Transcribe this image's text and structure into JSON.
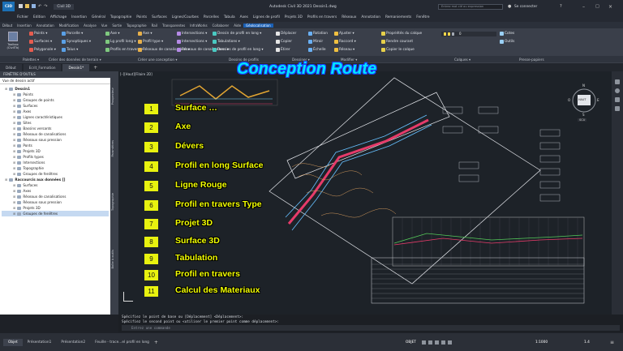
{
  "app": {
    "title": "Autodesk Civil 3D 2021   Dessin1.dwg",
    "search_placeholder": "Entrez mot clé ou expression",
    "signin": "Se connecter",
    "workspace": "Civil 3D",
    "logo": "C3D"
  },
  "menubar": [
    "Fichier",
    "Edition",
    "Affichage",
    "Insertion",
    "Général",
    "Topographie",
    "Points",
    "Surfaces",
    "Lignes/Courbes",
    "Parcelles",
    "Tabula",
    "Axes",
    "Lignes de profil",
    "Projets 3D",
    "Profils en travers",
    "Réseaux",
    "Annotation",
    "Remaniements",
    "Fenêtre"
  ],
  "ribbon_tabs": {
    "items": [
      "Début",
      "Insertion",
      "Annotation",
      "Modification",
      "Analyse",
      "Vue",
      "Sortie",
      "Topographie",
      "Rail",
      "Transparentes",
      "InfraWorks",
      "Collaborer",
      "Aide",
      "Géolocalisation"
    ],
    "active_index": 13
  },
  "ribbon": {
    "workspace_btn": "Toolbox (CivilTb)",
    "col1": [
      "Points ▾",
      "Surfaces ▾",
      "Polygonale ▾"
    ],
    "col2": [
      "Parcelle ▾",
      "Synoptiques ▾",
      "Talus ▾"
    ],
    "col3": [
      "Axe ▾",
      "Lg profil long ▾",
      "Profils en travers ▾"
    ],
    "col4": [
      "Axe ▾",
      "Profil type ▾",
      "Réseaux de canalisations ▾"
    ],
    "col5": [
      "Intersections ▾",
      "Intersections ▾",
      "Réseaux de canalisations ▾"
    ],
    "col6": [
      "Dessin de profil en long ▾",
      "Tabulations ▾",
      "Dessins de profil en long ▾"
    ],
    "col7": [
      "Déplacer",
      "Copier",
      "Étirer"
    ],
    "col8": [
      "Rotation",
      "Miroir",
      "Échelle"
    ],
    "col9": [
      "Ajuster ▾",
      "Raccord ▾",
      "Réseau ▾"
    ],
    "col10": [
      "Propriétés du calque",
      "Rendre courant",
      "Copier le calque"
    ],
    "col11": [
      "Cotes",
      "Outils"
    ],
    "layer": "0"
  },
  "panel_titles": [
    "Palettes ▾",
    "Créer des données de terrain ▾",
    "Créer une conception ▾",
    "Dessins de profils",
    "Dessiner ▾",
    "Modifier ▾",
    "Calques ▾",
    "Presse-papiers"
  ],
  "doc_tabs": [
    "Début",
    "Ecrit_Formation",
    "Dessin1*"
  ],
  "toolspace": {
    "title": "FENÊTRE D'OUTILS",
    "view": "Vue de dessin actif",
    "tree": [
      {
        "label": "Dessin1",
        "level": 0
      },
      {
        "label": "Points",
        "level": 1
      },
      {
        "label": "Groupes de points",
        "level": 1
      },
      {
        "label": "Surfaces",
        "level": 1
      },
      {
        "label": "Axes",
        "level": 1
      },
      {
        "label": "Lignes caractéristiques",
        "level": 1
      },
      {
        "label": "Sites",
        "level": 1
      },
      {
        "label": "Bassins versants",
        "level": 1
      },
      {
        "label": "Réseaux de canalisations",
        "level": 1
      },
      {
        "label": "Réseaux sous pression",
        "level": 1
      },
      {
        "label": "Ponts",
        "level": 1
      },
      {
        "label": "Projets 3D",
        "level": 1
      },
      {
        "label": "Profils types",
        "level": 1
      },
      {
        "label": "Intersections",
        "level": 1
      },
      {
        "label": "Topographie",
        "level": 1
      },
      {
        "label": "Groupes de fenêtres",
        "level": 1
      },
      {
        "label": "Raccourcis aux données []",
        "level": 0
      },
      {
        "label": "Surfaces",
        "level": 1
      },
      {
        "label": "Axes",
        "level": 1
      },
      {
        "label": "Réseaux de canalisations",
        "level": 1
      },
      {
        "label": "Réseaux sous pression",
        "level": 1
      },
      {
        "label": "Projets 3D",
        "level": 1
      },
      {
        "label": "Groupes de fenêtres",
        "level": 1
      }
    ]
  },
  "side_tabs": [
    "Prospecteur",
    "Paramètres",
    "Topographie",
    "Boîte à outils"
  ],
  "viewport_label": "[–][Haut][Filaire 2D]",
  "overlay_title": "Conception Route",
  "steps": [
    {
      "n": "1",
      "label": "Surface …"
    },
    {
      "n": "2",
      "label": "Axe"
    },
    {
      "n": "3",
      "label": "Dévers"
    },
    {
      "n": "4",
      "label": "Profil en long Surface"
    },
    {
      "n": "5",
      "label": "Ligne Rouge"
    },
    {
      "n": "6",
      "label": "Profil en travers Type"
    },
    {
      "n": "7",
      "label": "Projet  3D"
    },
    {
      "n": "8",
      "label": "Surface  3D"
    },
    {
      "n": "9",
      "label": "Tabulation"
    },
    {
      "n": "10",
      "label": "Profil en travers"
    },
    {
      "n": "11",
      "label": "Calcul des Materiaux"
    }
  ],
  "viewcube": {
    "n": "N",
    "s": "S",
    "w": "O",
    "e": "E",
    "face": "HAUT",
    "ucs": "SCU"
  },
  "command": {
    "line1": "Spécifiez le point de base ou [Déplacement] <Déplacement>:",
    "line2": "Spécifiez le second point ou <utiliser le premier point comme déplacement>:",
    "placeholder": "Entrez une commande"
  },
  "layout_tabs": [
    "Objet",
    "Présentation1",
    "Présentation2",
    "Feuille - trace...el profil en long"
  ],
  "status": {
    "model": "OBJET",
    "scale": "1:1000",
    "zoom": "1.4"
  }
}
